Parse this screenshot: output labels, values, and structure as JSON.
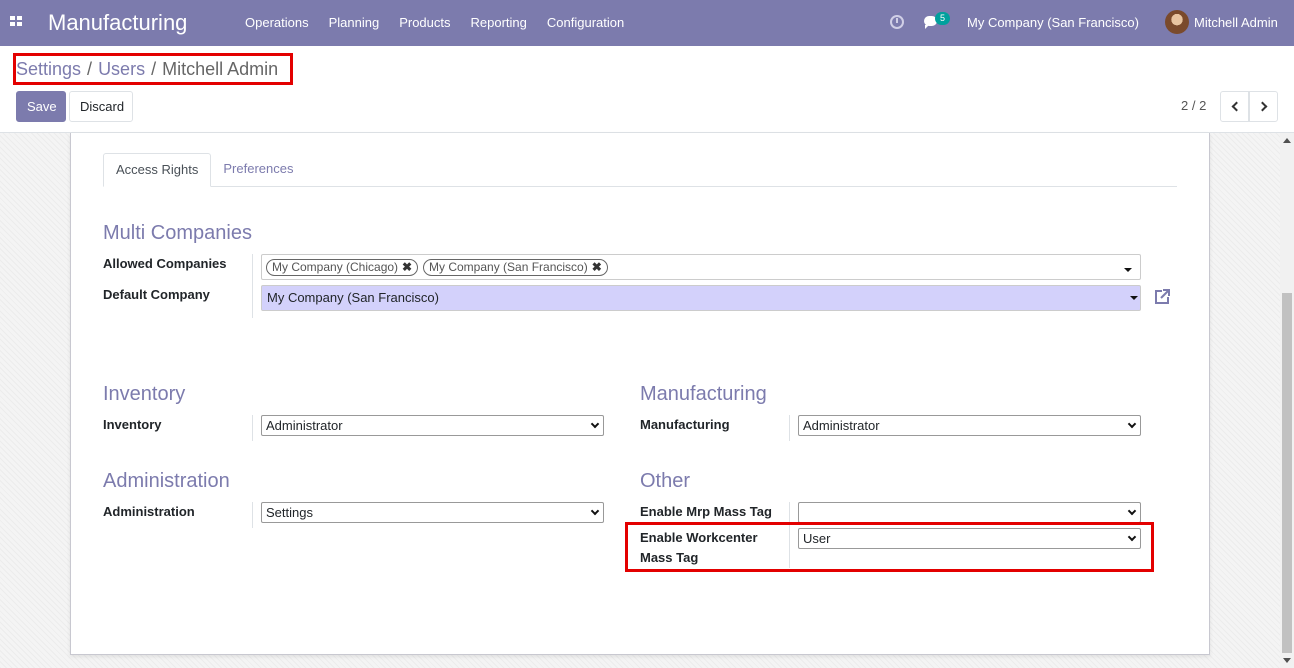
{
  "navbar": {
    "brand": "Manufacturing",
    "menu": [
      "Operations",
      "Planning",
      "Products",
      "Reporting",
      "Configuration"
    ],
    "chat_count": "5",
    "company": "My Company (San Francisco)",
    "user": "Mitchell Admin"
  },
  "breadcrumb": {
    "items": [
      "Settings",
      "Users",
      "Mitchell Admin"
    ],
    "separator": "/"
  },
  "toolbar": {
    "save_label": "Save",
    "discard_label": "Discard",
    "pager": "2 / 2"
  },
  "tabs": {
    "access_rights": "Access Rights",
    "preferences": "Preferences"
  },
  "multi_companies": {
    "title": "Multi Companies",
    "allowed_label": "Allowed Companies",
    "allowed_tags": [
      "My Company (Chicago)",
      "My Company (San Francisco)"
    ],
    "default_label": "Default Company",
    "default_value": "My Company (San Francisco)"
  },
  "inventory": {
    "title": "Inventory",
    "label": "Inventory",
    "value": "Administrator"
  },
  "manufacturing": {
    "title": "Manufacturing",
    "label": "Manufacturing",
    "value": "Administrator"
  },
  "administration": {
    "title": "Administration",
    "label": "Administration",
    "value": "Settings"
  },
  "other": {
    "title": "Other",
    "mrp_mass_tag_label": "Enable Mrp Mass Tag",
    "mrp_mass_tag_value": "",
    "workcenter_label_line1": "Enable Workcenter",
    "workcenter_label_line2": "Mass Tag",
    "workcenter_value": "User"
  },
  "colors": {
    "primary": "#7c7bad",
    "highlight": "#e30000",
    "badge": "#00a09d",
    "selected_field": "#d3d1fb"
  }
}
